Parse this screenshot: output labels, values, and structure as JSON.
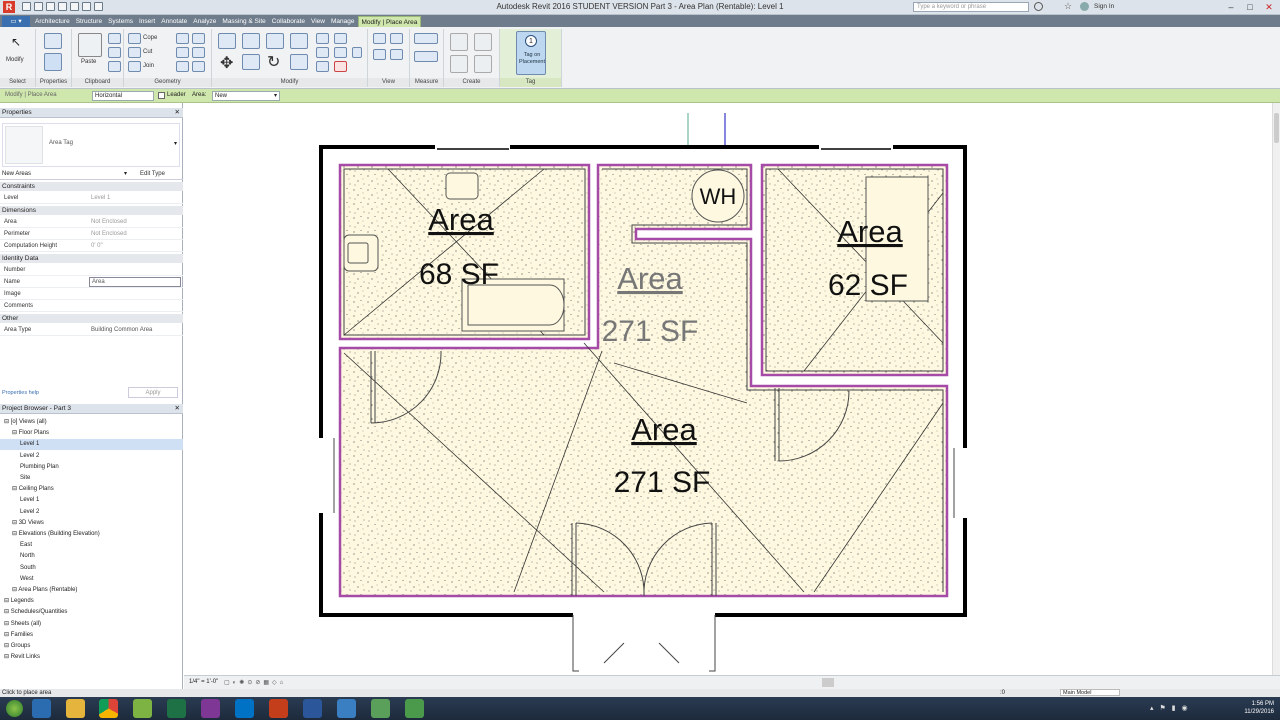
{
  "titlebar": {
    "title": "Autodesk Revit 2016    STUDENT VERSION     Part 3  -  Area Plan (Rentable): Level 1",
    "search_placeholder": "Type a keyword or phrase",
    "user": "Sign In"
  },
  "tabs": [
    "Architecture",
    "Structure",
    "Systems",
    "Insert",
    "Annotate",
    "Analyze",
    "Massing & Site",
    "Collaborate",
    "View",
    "Manage",
    "Modify | Place Area"
  ],
  "active_tab_index": 10,
  "ribbon": {
    "modify_label": "Modify",
    "paste_label": "Paste",
    "cope_label": "Cope",
    "cut_label": "Cut",
    "join_label": "Join",
    "tag_on_placement_label": "Tag on Placement",
    "panels": [
      "Select",
      "Properties",
      "Clipboard",
      "Geometry",
      "Modify",
      "View",
      "Measure",
      "Create",
      "Tag"
    ]
  },
  "optionsbar": {
    "context": "Modify | Place Area",
    "orientation": "Horizontal",
    "leader_label": "Leader",
    "area_label": "Area:",
    "area_value": "New"
  },
  "properties": {
    "header": "Properties",
    "type_name": "Area Tag",
    "instance_filter": "New Areas",
    "edit_type": "Edit Type",
    "sections": {
      "constraints": "Constraints",
      "dimensions": "Dimensions",
      "identity": "Identity Data",
      "other": "Other"
    },
    "rows": {
      "level": {
        "k": "Level",
        "v": "Level 1"
      },
      "area": {
        "k": "Area",
        "v": "Not Enclosed"
      },
      "perimeter": {
        "k": "Perimeter",
        "v": "Not Enclosed"
      },
      "comp_height": {
        "k": "Computation Height",
        "v": "0' 0\""
      },
      "number": {
        "k": "Number",
        "v": ""
      },
      "name": {
        "k": "Name",
        "v": "Area"
      },
      "image": {
        "k": "Image",
        "v": ""
      },
      "comments": {
        "k": "Comments",
        "v": ""
      },
      "area_type": {
        "k": "Area Type",
        "v": "Building Common Area"
      }
    },
    "help_link": "Properties help",
    "apply": "Apply"
  },
  "browser": {
    "header": "Project Browser - Part 3",
    "items": [
      {
        "label": "[o] Views (all)",
        "indent": 0
      },
      {
        "label": "Floor Plans",
        "indent": 1
      },
      {
        "label": "Level 1",
        "indent": 2,
        "selected": true
      },
      {
        "label": "Level 2",
        "indent": 2
      },
      {
        "label": "Plumbing Plan",
        "indent": 2
      },
      {
        "label": "Site",
        "indent": 2
      },
      {
        "label": "Ceiling Plans",
        "indent": 1
      },
      {
        "label": "Level 1",
        "indent": 2
      },
      {
        "label": "Level 2",
        "indent": 2
      },
      {
        "label": "3D Views",
        "indent": 1
      },
      {
        "label": "Elevations (Building Elevation)",
        "indent": 1
      },
      {
        "label": "East",
        "indent": 2
      },
      {
        "label": "North",
        "indent": 2
      },
      {
        "label": "South",
        "indent": 2
      },
      {
        "label": "West",
        "indent": 2
      },
      {
        "label": "Area Plans (Rentable)",
        "indent": 1
      },
      {
        "label": "Legends",
        "indent": 0
      },
      {
        "label": "Schedules/Quantities",
        "indent": 0
      },
      {
        "label": "Sheets (all)",
        "indent": 0
      },
      {
        "label": "Families",
        "indent": 0
      },
      {
        "label": "Groups",
        "indent": 0
      },
      {
        "label": "Revit Links",
        "indent": 0
      }
    ]
  },
  "plan": {
    "wh_label": "WH",
    "rooms": [
      {
        "name": "Area",
        "size": "68 SF"
      },
      {
        "name": "Area",
        "size": "271 SF"
      },
      {
        "name": "Area",
        "size": "62 SF"
      },
      {
        "name": "Area",
        "size": "271 SF"
      }
    ]
  },
  "status": {
    "scale": "1/4\" = 1'-0\"",
    "message": "Click to place area",
    "main_model": "Main Model",
    "zero": ":0"
  },
  "taskbar": {
    "time": "1:56 PM",
    "date": "11/29/2016"
  },
  "colors": {
    "area_fill": "#fdf8df",
    "area_boundary": "#a64aa8",
    "ribbon_context": "#cfe6ad"
  }
}
